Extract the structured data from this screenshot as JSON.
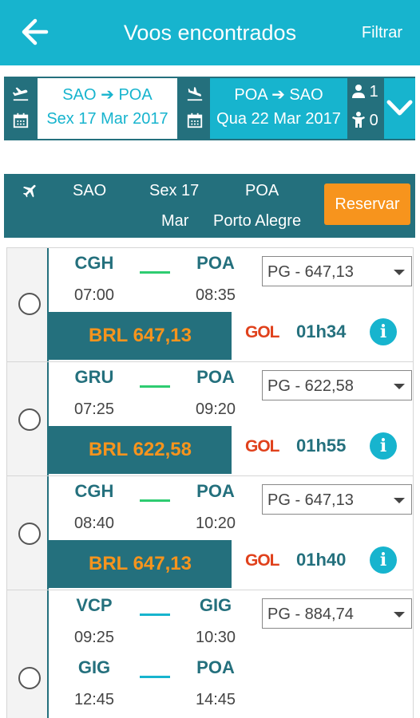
{
  "header": {
    "title": "Voos encontrados",
    "filter_label": "Filtrar"
  },
  "search": {
    "outbound": {
      "route_from": "SAO",
      "route_to": "POA",
      "date": "Sex 17 Mar 2017"
    },
    "return": {
      "route_from": "POA",
      "route_to": "SAO",
      "date": "Qua 22 Mar 2017"
    },
    "adults": "1",
    "children": "0"
  },
  "leg_header": {
    "origin": "SAO",
    "day": "Sex 17",
    "month": "Mar",
    "dest": "POA",
    "dest_city": "Porto Alegre",
    "reserve_label": "Reservar"
  },
  "flights": [
    {
      "segments": [
        {
          "from": "CGH",
          "dep": "07:00",
          "to": "POA",
          "arr": "08:35",
          "color": "#2ecc71"
        }
      ],
      "fare": "PG - 647,13",
      "price": "BRL 647,13",
      "airline": "GOL",
      "duration": "01h34"
    },
    {
      "segments": [
        {
          "from": "GRU",
          "dep": "07:25",
          "to": "POA",
          "arr": "09:20",
          "color": "#2ecc71"
        }
      ],
      "fare": "PG - 622,58",
      "price": "BRL 622,58",
      "airline": "GOL",
      "duration": "01h55"
    },
    {
      "segments": [
        {
          "from": "CGH",
          "dep": "08:40",
          "to": "POA",
          "arr": "10:20",
          "color": "#2ecc71"
        }
      ],
      "fare": "PG - 647,13",
      "price": "BRL 647,13",
      "airline": "GOL",
      "duration": "01h40"
    },
    {
      "segments": [
        {
          "from": "VCP",
          "dep": "09:25",
          "to": "GIG",
          "arr": "10:30",
          "color": "#17b4ce"
        },
        {
          "from": "GIG",
          "dep": "12:45",
          "to": "POA",
          "arr": "14:45",
          "color": "#17b4ce"
        }
      ],
      "fare": "PG - 884,74"
    }
  ],
  "colors": {
    "primary": "#17b4ce",
    "dark": "#24707d",
    "accent": "#f7941d",
    "airline": "#e0411c"
  }
}
